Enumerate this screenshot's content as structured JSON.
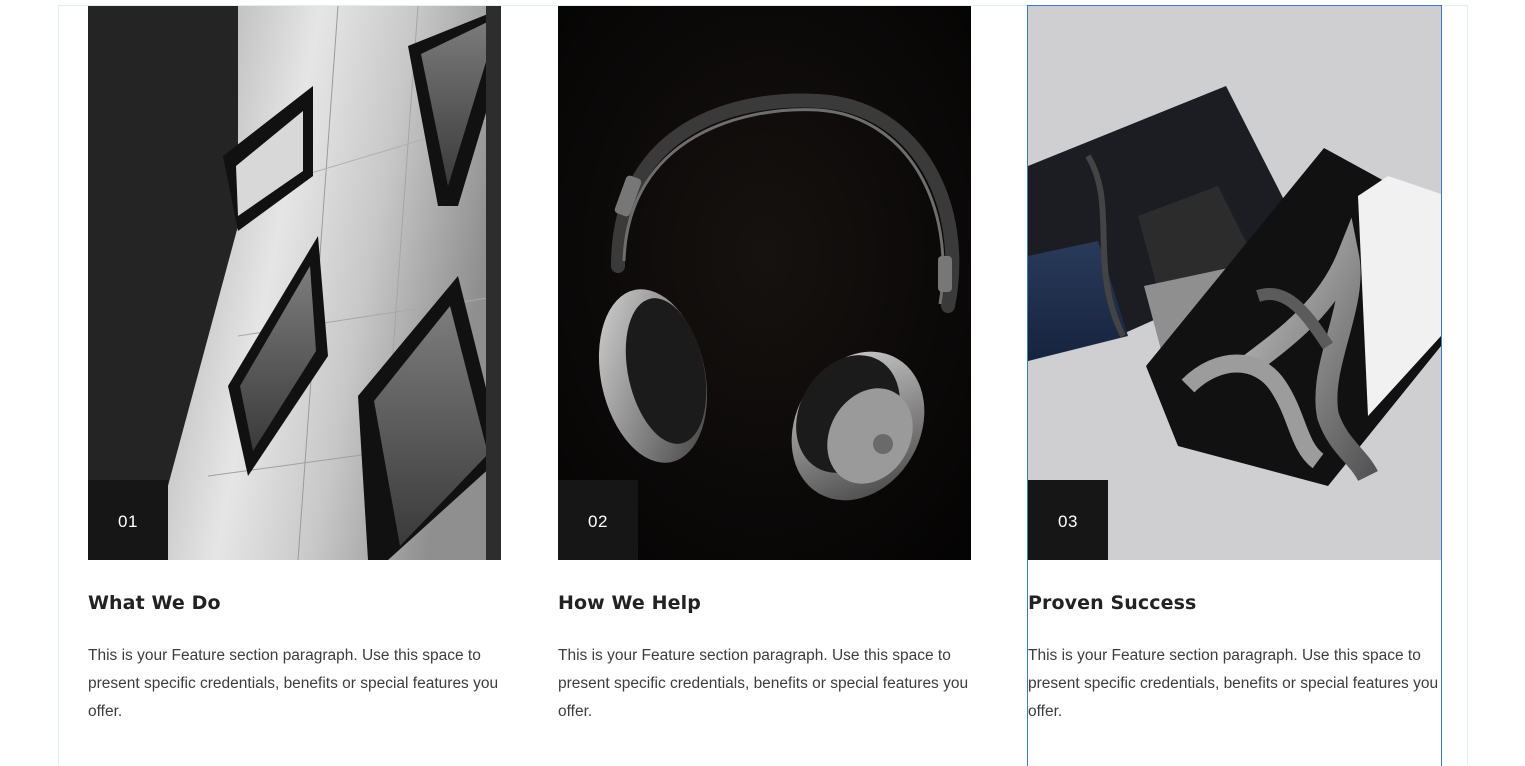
{
  "features": [
    {
      "number": "01",
      "title": "What We Do",
      "text": "This is your Feature section paragraph. Use this space to present specific credentials, benefits or special features you offer.",
      "image": "building-windows-photo"
    },
    {
      "number": "02",
      "title": "How We Help",
      "text": "This is your Feature section paragraph. Use this space to present specific credentials, benefits or special features you offer.",
      "image": "headphones-photo"
    },
    {
      "number": "03",
      "title": "Proven Success",
      "text": "This is your Feature section paragraph. Use this space to present specific credentials, benefits or special features you offer.",
      "image": "photo-prints-photo"
    }
  ],
  "colors": {
    "badge_background": "#161616",
    "title_text": "#222222",
    "body_text": "#3d3d3d",
    "selection_outline": "#3b79c6"
  }
}
